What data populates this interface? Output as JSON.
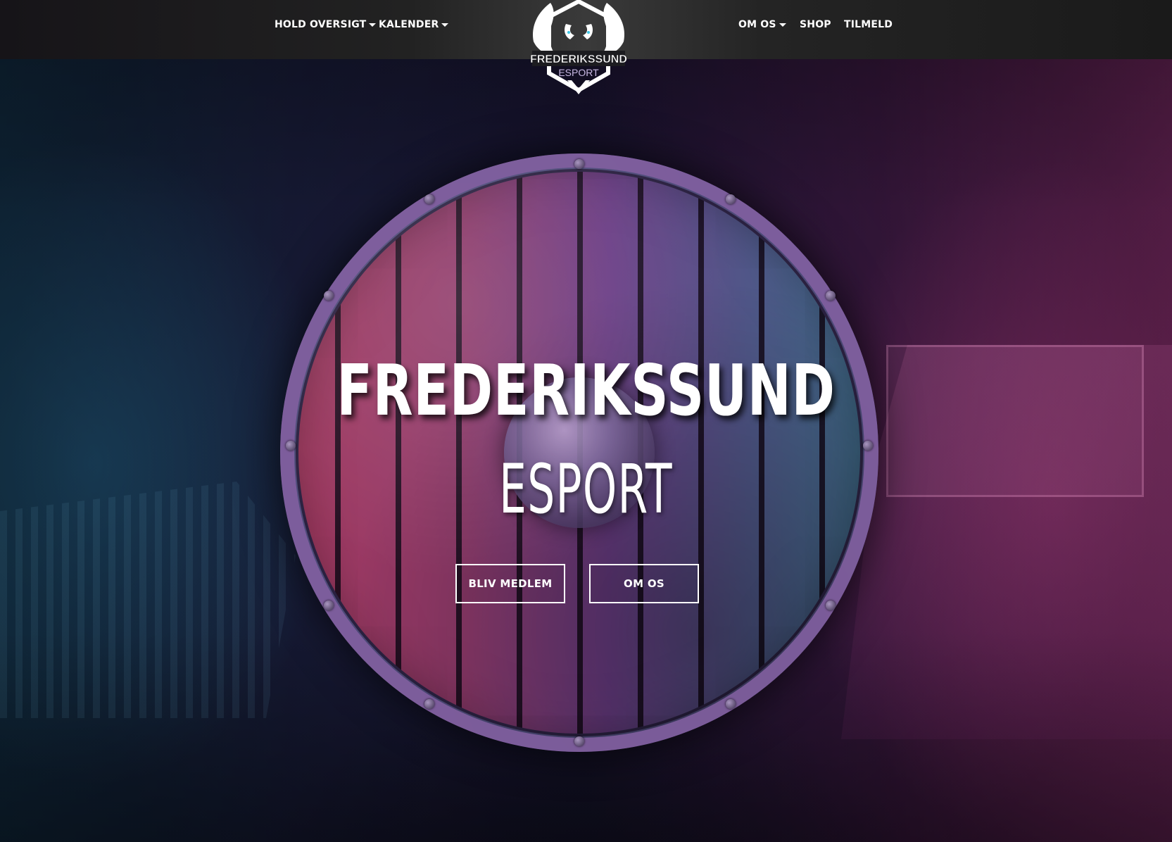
{
  "nav": {
    "left_items": [
      {
        "label": "HOLD OVERSIGT",
        "has_dropdown": true
      },
      {
        "label": "KALENDER",
        "has_dropdown": true
      }
    ],
    "right_items": [
      {
        "label": "OM OS",
        "has_dropdown": true
      },
      {
        "label": "SHOP",
        "has_dropdown": false
      },
      {
        "label": "TILMELD",
        "has_dropdown": false
      }
    ]
  },
  "logo": {
    "line1": "FREDERIKSSUND",
    "line2": "ESPORT",
    "icon": "phoenix-hexagon-icon"
  },
  "hero": {
    "title": "FREDERIKSSUND",
    "subtitle": "ESPORT",
    "buttons": [
      {
        "label": "BLIV MEDLEM"
      },
      {
        "label": "OM OS"
      }
    ]
  },
  "colors": {
    "nav_background": "#222222",
    "text": "#ffffff",
    "hero_left_tint": "#14314a",
    "hero_right_tint": "#7a2a66",
    "shield_red": "#a53a60",
    "shield_blue": "#3d6b86"
  }
}
